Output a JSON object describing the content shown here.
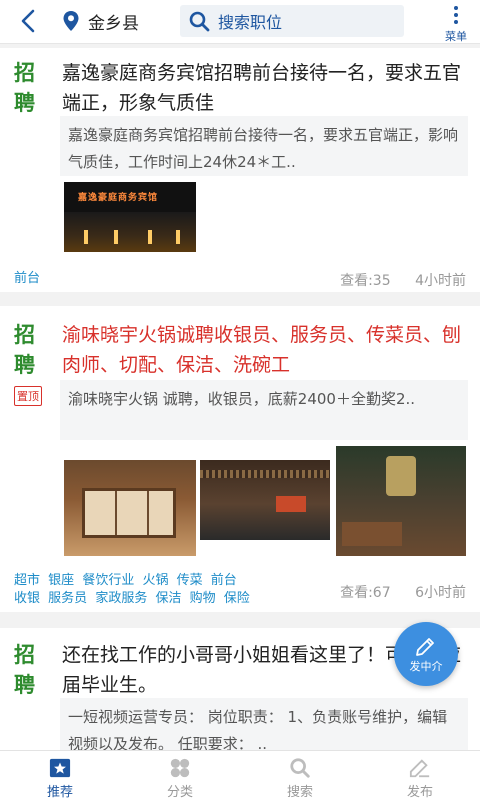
{
  "header": {
    "city": "金乡县",
    "search_placeholder": "搜索职位",
    "menu_label": "菜单"
  },
  "posts": [
    {
      "badge": [
        "招",
        "聘"
      ],
      "title": "嘉逸豪庭商务宾馆招聘前台接待一名，要求五官端正，形象气质佳",
      "description": "嘉逸豪庭商务宾馆招聘前台接待一名，要求五官端正，影响气质佳，工作时间上24休24＊工..",
      "image_sign": "嘉逸豪庭商务宾馆",
      "tags": [
        "前台"
      ],
      "views": "查看:35",
      "time": "4小时前"
    },
    {
      "badge": [
        "招",
        "聘"
      ],
      "pinned_label": "置顶",
      "title": "渝味晓宇火锅诚聘收银员、服务员、传菜员、刨肉师、切配、保洁、洗碗工",
      "description": "渝味晓宇火锅 诚聘，收银员，底薪2400＋全勤奖2..",
      "tags_row1": [
        "超市",
        "银座",
        "餐饮行业",
        "火锅",
        "传菜",
        "前台"
      ],
      "tags_row2": [
        "收银",
        "服务员",
        "家政服务",
        "保洁",
        "购物",
        "保险"
      ],
      "views": "查看:67",
      "time": "6小时前"
    },
    {
      "badge": [
        "招",
        "聘"
      ],
      "title": "还在找工作的小哥哥小姐姐看这里了！可接受应届毕业生。",
      "description": "一短视频运营专员： 岗位职责： 1、负责账号维护，编辑视频以及发布。 任职要求： .."
    }
  ],
  "fab_label": "发中介",
  "bottom_nav": {
    "tabs": [
      {
        "label": "推荐",
        "icon": "recommend-icon",
        "active": true
      },
      {
        "label": "分类",
        "icon": "category-icon",
        "active": false
      },
      {
        "label": "搜索",
        "icon": "search-icon",
        "active": false
      },
      {
        "label": "发布",
        "icon": "publish-icon",
        "active": false
      }
    ]
  },
  "colors": {
    "primary": "#1e56a0",
    "badge_green": "#2e8b2e",
    "highlight_red": "#d8312b",
    "tag_blue": "#1e8cc8",
    "fab_blue": "#3d8fe0"
  }
}
